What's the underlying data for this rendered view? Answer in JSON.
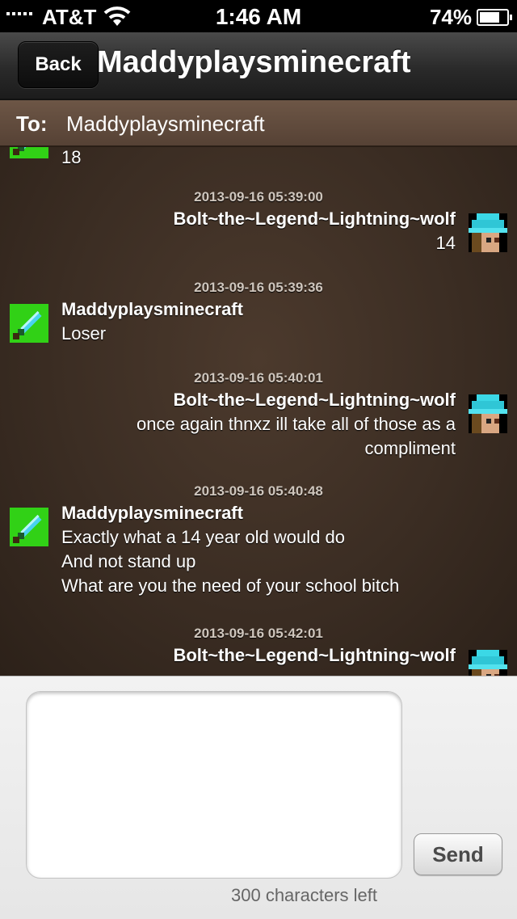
{
  "status_bar": {
    "carrier": "AT&T",
    "time": "1:46 AM",
    "battery_percent": "74%",
    "signal_bars": 5,
    "icons": [
      "signal-bars-icon",
      "wifi-icon",
      "battery-icon"
    ]
  },
  "nav": {
    "back_label": "Back",
    "title": "Maddyplaysminecraft"
  },
  "to": {
    "label": "To:",
    "value": "Maddyplaysminecraft"
  },
  "messages": [
    {
      "side": "left",
      "sender": "",
      "timestamp": "",
      "lines": [
        "18"
      ],
      "avatar": "diamond-sword-avatar"
    },
    {
      "side": "right",
      "timestamp": "2013-09-16 05:39:00",
      "sender": "Bolt~the~Legend~Lightning~wolf",
      "lines": [
        "14"
      ],
      "avatar": "wolf-skin-avatar"
    },
    {
      "side": "left",
      "timestamp": "2013-09-16 05:39:36",
      "sender": "Maddyplaysminecraft",
      "lines": [
        "Loser"
      ],
      "avatar": "diamond-sword-avatar"
    },
    {
      "side": "right",
      "timestamp": "2013-09-16 05:40:01",
      "sender": "Bolt~the~Legend~Lightning~wolf",
      "lines": [
        "once again thnxz ill take all of those as a",
        "compliment"
      ],
      "avatar": "wolf-skin-avatar"
    },
    {
      "side": "left",
      "timestamp": "2013-09-16 05:40:48",
      "sender": "Maddyplaysminecraft",
      "lines": [
        "Exactly what a 14 year old would do",
        "And not stand up",
        "What are you the need of your school bitch"
      ],
      "avatar": "diamond-sword-avatar"
    },
    {
      "side": "right",
      "timestamp": "2013-09-16 05:42:01",
      "sender": "Bolt~the~Legend~Lightning~wolf",
      "lines": [],
      "avatar": "wolf-skin-avatar"
    }
  ],
  "composer": {
    "input_value": "",
    "send_label": "Send",
    "char_count": "300 characters left"
  },
  "colors": {
    "background_brown": "#3b2d23",
    "to_bar_brown": "#564235",
    "sword_avatar_green": "#31d116",
    "wolf_avatar_cyan": "#2fc6d6"
  }
}
